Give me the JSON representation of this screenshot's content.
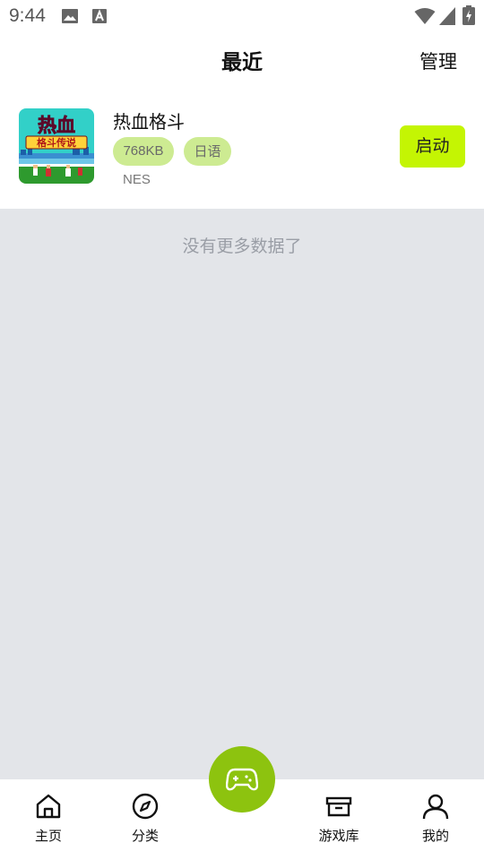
{
  "status_bar": {
    "time": "9:44",
    "icons": [
      "image-icon",
      "text-a-icon",
      "wifi-icon",
      "signal-icon",
      "battery-icon"
    ]
  },
  "header": {
    "title": "最近",
    "manage_label": "管理"
  },
  "game": {
    "title": "热血格斗",
    "size": "768KB",
    "language": "日语",
    "platform": "NES",
    "launch_label": "启动",
    "thumbnail_title_art": "热血",
    "thumbnail_subtitle_art": "格斗传说"
  },
  "empty_message": "没有更多数据了",
  "bottom_nav": {
    "items": [
      {
        "label": "主页",
        "icon": "home-icon"
      },
      {
        "label": "分类",
        "icon": "compass-icon"
      },
      {
        "label": "游戏库",
        "icon": "archive-box-icon"
      },
      {
        "label": "我的",
        "icon": "user-icon"
      }
    ],
    "fab_icon": "gamepad-icon"
  },
  "colors": {
    "accent": "#c4f503",
    "tag_bg": "#cdeb92",
    "fab": "#8dc30f",
    "content_bg": "#e3e5e9"
  }
}
